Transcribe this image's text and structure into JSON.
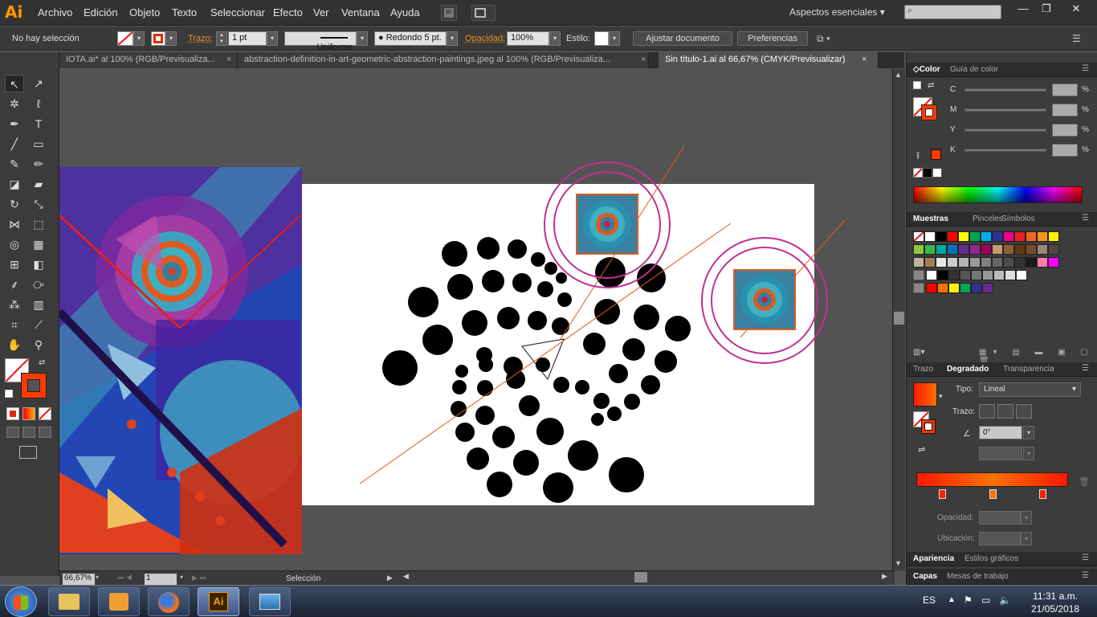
{
  "app": {
    "logo": "Ai",
    "icon": "illustrator-icon"
  },
  "menu": [
    "Archivo",
    "Edición",
    "Objeto",
    "Texto",
    "Seleccionar",
    "Efecto",
    "Ver",
    "Ventana",
    "Ayuda"
  ],
  "workspace": "Aspectos esenciales",
  "control_bar": {
    "selection_status": "No hay selección",
    "stroke_label": "Trazo:",
    "stroke_value": "1 pt",
    "profile": "Uniforme",
    "brush": "Redondo 5 pt.",
    "opacity_label": "Opacidad:",
    "opacity_value": "100%",
    "style_label": "Estilo:",
    "adjust_btn": "Ajustar documento",
    "prefs_btn": "Preferencias"
  },
  "tabs": [
    {
      "label": "IOTA.ai* al 100% (RGB/Previsualiza...",
      "close": "×"
    },
    {
      "label": "abstraction-definition-in-art-geometric-abstraction-paintings.jpeg al 100% (RGB/Previsualiza...",
      "close": "×"
    },
    {
      "label": "Sin título-1.ai al 66,67% (CMYK/Previsualizar)",
      "close": "×"
    }
  ],
  "status": {
    "zoom": "66,67%",
    "page": "1",
    "tool": "Selección"
  },
  "color_panel": {
    "tabs": [
      "Color",
      "Guía de color"
    ],
    "channels": [
      {
        "label": "C",
        "value": "",
        "unit": "%"
      },
      {
        "label": "M",
        "value": "",
        "unit": "%"
      },
      {
        "label": "Y",
        "value": "",
        "unit": "%"
      },
      {
        "label": "K",
        "value": "",
        "unit": "%"
      }
    ]
  },
  "swatches_panel": {
    "tabs": [
      "Muestras",
      "Pinceles",
      "Símbolos"
    ]
  },
  "gradient_panel": {
    "tabs": [
      "Trazo",
      "Degradado",
      "Transparencia"
    ],
    "type_label": "Tipo:",
    "type_value": "Lineal",
    "stroke_label": "Trazo:",
    "angle": "0°",
    "opacity_label": "Opacidad:",
    "location_label": "Ubicación:"
  },
  "appearance_panel": {
    "tabs": [
      "Apariencia",
      "Estilos gráficos"
    ]
  },
  "layers_panel": {
    "tabs": [
      "Capas",
      "Mesas de trabajo"
    ]
  },
  "taskbar": {
    "lang": "ES",
    "time": "11:31 a.m.",
    "date": "21/05/2018"
  },
  "colors": {
    "accent": "#ff9a00",
    "guide_line": "#e05a20",
    "ring": "#c03090",
    "gradient_start": "#ff1800",
    "gradient_end": "#ff7000"
  }
}
